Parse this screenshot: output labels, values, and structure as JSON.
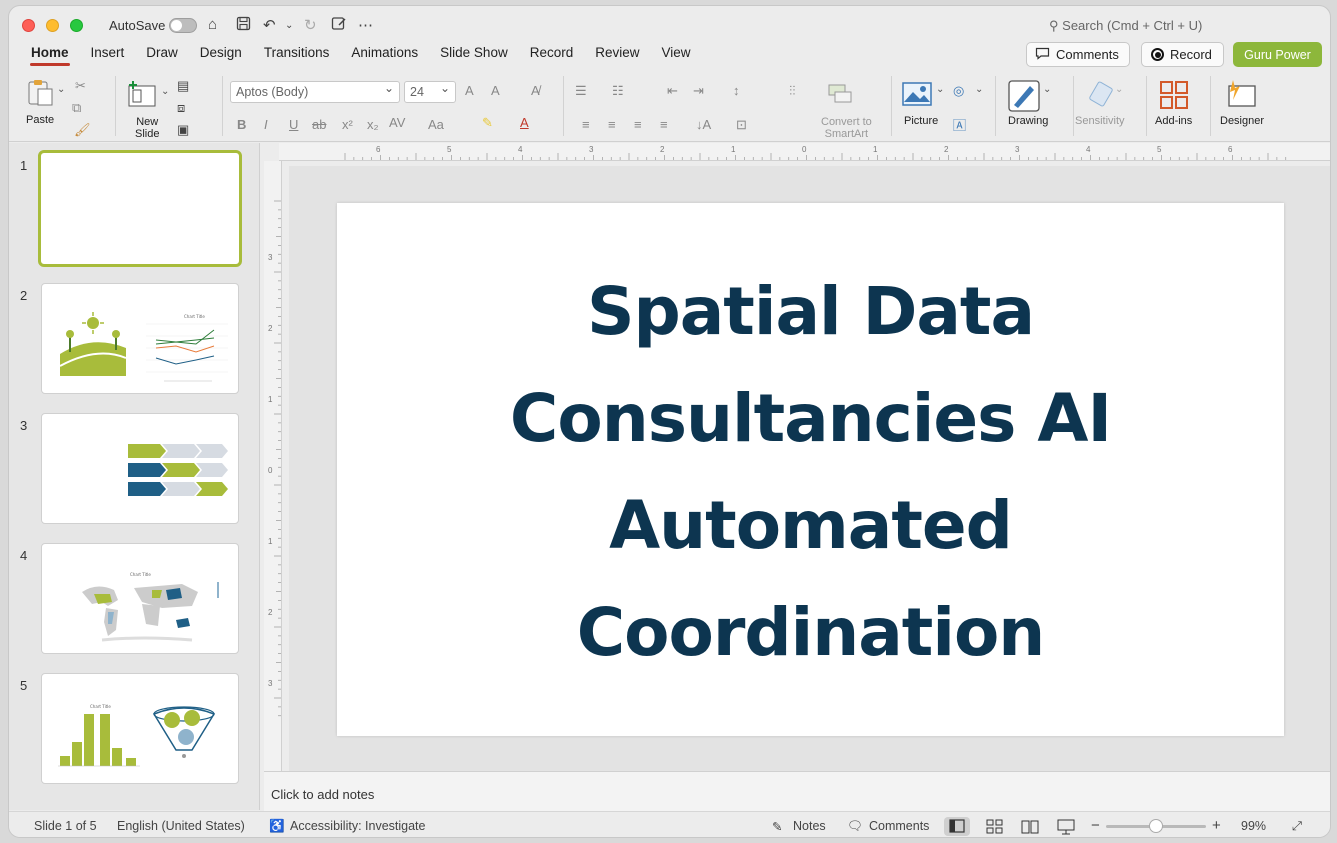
{
  "titlebar": {
    "autosave_label": "AutoSave",
    "search_placeholder": "Search (Cmd + Ctrl + U)"
  },
  "tabs": [
    {
      "label": "Home",
      "active": true
    },
    {
      "label": "Insert"
    },
    {
      "label": "Draw"
    },
    {
      "label": "Design"
    },
    {
      "label": "Transitions"
    },
    {
      "label": "Animations"
    },
    {
      "label": "Slide Show"
    },
    {
      "label": "Record"
    },
    {
      "label": "Review"
    },
    {
      "label": "View"
    }
  ],
  "top_actions": {
    "comments_label": "Comments",
    "record_label": "Record",
    "guru_label": "Guru Power",
    "guru_color": "#8db73b"
  },
  "ribbon": {
    "paste_label": "Paste",
    "new_slide_label": "New\nSlide",
    "font_name": "Aptos (Body)",
    "font_size": "24",
    "convert_label": "Convert to\nSmartArt",
    "picture_label": "Picture",
    "drawing_label": "Drawing",
    "sensitivity_label": "Sensitivity",
    "addins_label": "Add-ins",
    "designer_label": "Designer"
  },
  "thumbnails": [
    {
      "number": "1",
      "selected": true
    },
    {
      "number": "2"
    },
    {
      "number": "3"
    },
    {
      "number": "4"
    },
    {
      "number": "5"
    }
  ],
  "ruler": {
    "horizontal_ticks": [
      "6",
      "5",
      "4",
      "3",
      "2",
      "1",
      "0",
      "1",
      "2",
      "3",
      "4",
      "5",
      "6"
    ],
    "vertical_ticks": [
      "3",
      "2",
      "1",
      "0",
      "1",
      "2",
      "3"
    ]
  },
  "slide": {
    "title_lines": [
      "Spatial Data",
      "Consultancies AI",
      "Automated",
      "Coordination"
    ],
    "title_color": "#0d3550"
  },
  "notes": {
    "placeholder": "Click to add notes"
  },
  "status": {
    "slide_info": "Slide 1 of 5",
    "language": "English (United States)",
    "accessibility": "Accessibility: Investigate",
    "notes_label": "Notes",
    "comments_label": "Comments",
    "zoom": "99%"
  },
  "colors": {
    "accent_green": "#a8bc3b",
    "navy": "#0d3550",
    "teal_blue": "#1f5f86"
  }
}
